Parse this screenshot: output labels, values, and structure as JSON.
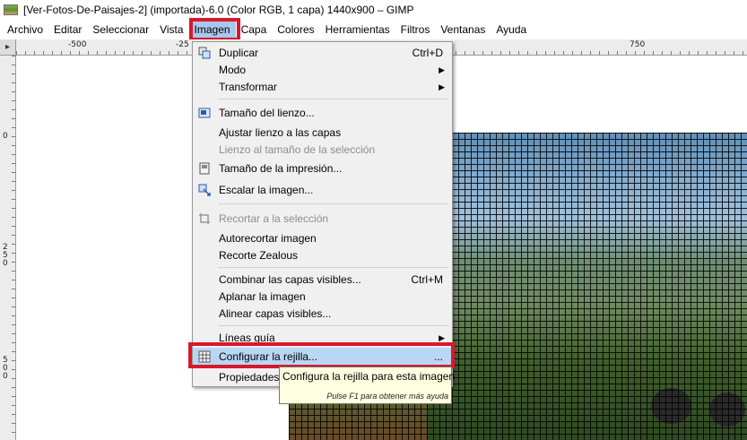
{
  "window": {
    "title": "[Ver-Fotos-De-Paisajes-2] (importada)-6.0 (Color RGB, 1 capa) 1440x900 – GIMP",
    "icon": "image-thumbnail-icon"
  },
  "menubar": {
    "items": [
      {
        "label": "Archivo"
      },
      {
        "label": "Editar"
      },
      {
        "label": "Seleccionar"
      },
      {
        "label": "Vista"
      },
      {
        "label": "Imagen",
        "active": true
      },
      {
        "label": "Capa"
      },
      {
        "label": "Colores"
      },
      {
        "label": "Herramientas"
      },
      {
        "label": "Filtros"
      },
      {
        "label": "Ventanas"
      },
      {
        "label": "Ayuda"
      }
    ]
  },
  "rulers": {
    "horizontal_labels": [
      "-500",
      "-25",
      "750"
    ],
    "vertical_labels": [
      "0",
      "250",
      "500"
    ]
  },
  "dropdown": {
    "items": [
      {
        "label": "Duplicar",
        "shortcut": "Ctrl+D",
        "icon": "duplicate-icon"
      },
      {
        "label": "Modo",
        "submenu": true
      },
      {
        "label": "Transformar",
        "submenu": true
      },
      {
        "label": "Tamaño del lienzo...",
        "icon": "canvas-size-icon"
      },
      {
        "label": "Ajustar lienzo a las capas"
      },
      {
        "label": "Lienzo al tamaño de la selección",
        "disabled": true
      },
      {
        "label": "Tamaño de la impresión...",
        "icon": "print-size-icon"
      },
      {
        "label": "Escalar la imagen...",
        "icon": "scale-image-icon"
      },
      {
        "label": "Recortar a la selección",
        "disabled": true,
        "icon": "crop-icon"
      },
      {
        "label": "Autorecortar imagen"
      },
      {
        "label": "Recorte Zealous"
      },
      {
        "label": "Combinar las capas visibles...",
        "shortcut": "Ctrl+M"
      },
      {
        "label": "Aplanar la imagen"
      },
      {
        "label": "Alinear capas visibles..."
      },
      {
        "label": "Líneas guía",
        "submenu": true
      },
      {
        "label": "Configurar la rejilla...",
        "highlighted": true,
        "shortcut": "...",
        "icon": "grid-icon"
      },
      {
        "label": "Propiedades"
      }
    ]
  },
  "tooltip": {
    "text": "Configura la rejilla para esta imagen",
    "hint": "Pulse F1 para obtener más ayuda"
  },
  "colors": {
    "highlight": "#b9d6f5",
    "annotation_red": "#d7192a",
    "tooltip_bg": "#ffffe1"
  }
}
